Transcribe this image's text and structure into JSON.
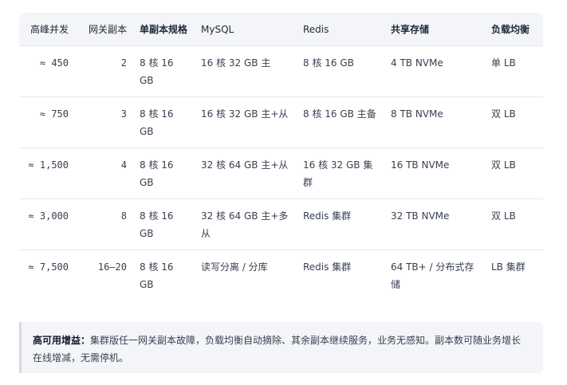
{
  "table": {
    "headers": [
      "高峰并发",
      "网关副本",
      "单副本规格",
      "MySQL",
      "Redis",
      "共享存储",
      "负载均衡"
    ],
    "rows": [
      [
        "≈ 450",
        "2",
        "8 核 16 GB",
        "16 核 32 GB 主",
        "8 核 16 GB",
        "4 TB NVMe",
        "单 LB"
      ],
      [
        "≈ 750",
        "3",
        "8 核 16 GB",
        "16 核 32 GB 主+从",
        "8 核 16 GB 主备",
        "8 TB NVMe",
        "双 LB"
      ],
      [
        "≈ 1,500",
        "4",
        "8 核 16 GB",
        "32 核 64 GB 主+从",
        "16 核 32 GB 集群",
        "16 TB NVMe",
        "双 LB"
      ],
      [
        "≈ 3,000",
        "8",
        "8 核 16 GB",
        "32 核 64 GB 主+多从",
        "Redis 集群",
        "32 TB NVMe",
        "双 LB"
      ],
      [
        "≈ 7,500",
        "16–20",
        "8 核 16 GB",
        "读写分离 / 分库",
        "Redis 集群",
        "64 TB+ / 分布式存储",
        "LB 集群"
      ]
    ]
  },
  "note": {
    "title": "高可用增益：",
    "text": "集群版任一网关副本故障，负载均衡自动摘除、其余副本继续服务，业务无感知。副本数可随业务增长在线增减，无需停机。"
  }
}
